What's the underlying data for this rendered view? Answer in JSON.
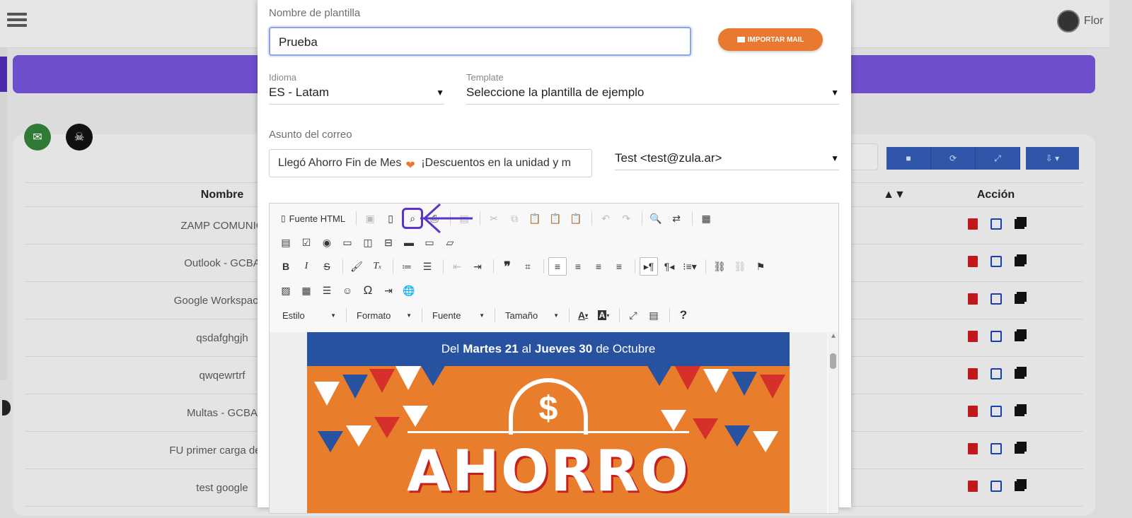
{
  "app": {
    "user_name": "Flor",
    "accent_purple": "#5b35c9",
    "import_color": "#e8792f"
  },
  "table": {
    "header_name": "Nombre",
    "header_action": "Acción",
    "rows": [
      "ZAMP COMUNIC",
      "Outlook - GCBA",
      "Google Workspace (",
      "qsdafghgjh",
      "qwqewrtrf",
      "Multas - GCBA",
      "FU primer carga de us",
      "test google"
    ]
  },
  "modal": {
    "name_label": "Nombre de plantilla",
    "name_value": "Prueba",
    "import_label": "IMPORTAR MAIL",
    "language_label": "Idioma",
    "language_value": "ES - Latam",
    "template_label": "Template",
    "template_value": "Seleccione la plantilla de ejemplo",
    "subject_label": "Asunto del correo",
    "subject_value_a": "Llegó Ahorro Fin de Mes",
    "subject_value_b": "¡Descuentos en la unidad y m",
    "sender_value": "Test <test@zula.ar>"
  },
  "editor": {
    "source_label": "Fuente HTML",
    "combo_style": "Estilo",
    "combo_format": "Formato",
    "combo_font": "Fuente",
    "combo_size": "Tamaño",
    "banner": {
      "prefix": "Del",
      "day1": "Martes 21",
      "mid": "al",
      "day2": "Jueves 30",
      "suffix": "de Octubre",
      "big_text": "AHORRO",
      "coin_symbol": "$"
    }
  }
}
